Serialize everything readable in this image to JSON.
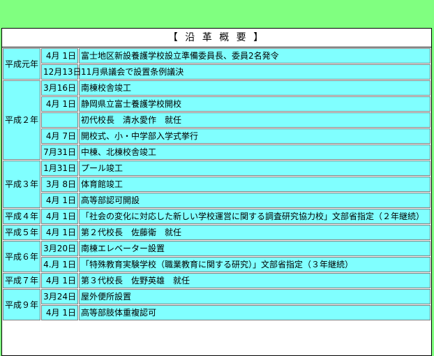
{
  "caption": "【 沿 革 概 要 】",
  "rows": [
    {
      "era": "平成元年",
      "date": "4月 1日",
      "text": "富士地区新設養護学校設立準備委員長、委員2名発令"
    },
    {
      "era": "",
      "date": "12月13日",
      "text": "11月県議会で設置条例議決"
    },
    {
      "era": "平成２年",
      "date": "3月16日",
      "text": "南棟校舎竣工"
    },
    {
      "era": "",
      "date": "4月 1日",
      "text": "静岡県立富士養護学校開校"
    },
    {
      "era": "",
      "date": "",
      "text": "初代校長　清水愛作　就任"
    },
    {
      "era": "",
      "date": "4月 7日",
      "text": "開校式、小・中学部入学式挙行"
    },
    {
      "era": "",
      "date": "7月31日",
      "text": "中棟、北棟校舎竣工"
    },
    {
      "era": "平成３年",
      "date": "1月31日",
      "text": "プール竣工"
    },
    {
      "era": "",
      "date": "3月 8日",
      "text": "体育館竣工"
    },
    {
      "era": "",
      "date": "4月 1日",
      "text": "高等部認可開設"
    },
    {
      "era": "平成４年",
      "date": "4月 1日",
      "text": "「社会の変化に対応した新しい学校運営に関する調査研究協力校」文部省指定（２年継続）"
    },
    {
      "era": "平成５年",
      "date": "4月 1日",
      "text": "第２代校長　佐藤衛　就任"
    },
    {
      "era": "平成６年",
      "date": "3月20日",
      "text": "南棟エレベーター設置"
    },
    {
      "era": "",
      "date": "4.月 1日",
      "text": "「特殊教育実験学校（職業教育に関する研究）」文部省指定（３年継続）"
    },
    {
      "era": "平成７年",
      "date": "4月 1日",
      "text": "第３代校長　佐野英雄　就任"
    },
    {
      "era": "平成９年",
      "date": "3月24日",
      "text": "屋外便所設置"
    },
    {
      "era": "",
      "date": "4月 1日",
      "text": "高等部肢体重複認可"
    }
  ]
}
